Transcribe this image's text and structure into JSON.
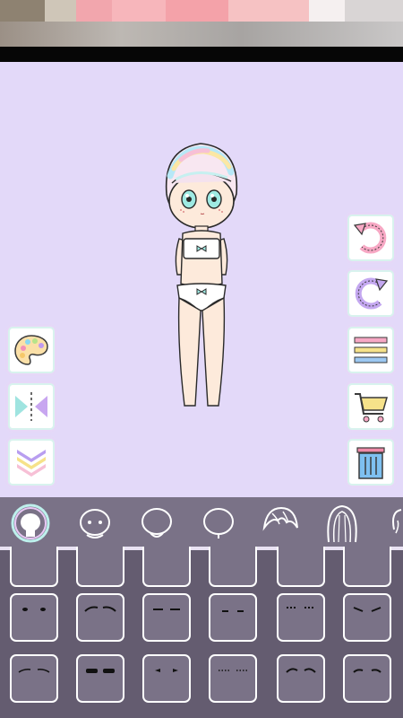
{
  "status_bar": {
    "blurred": true
  },
  "colors": {
    "canvas_bg": "#e3d9f9",
    "tab_bar_bg": "#7a7287",
    "grid_bg": "#645c70",
    "cell_border": "#ffffff"
  },
  "left_tools": [
    {
      "name": "color-palette-button",
      "icon": "palette-icon"
    },
    {
      "name": "flip-button",
      "icon": "mirror-flip-icon"
    },
    {
      "name": "collapse-button",
      "icon": "chevrons-down-icon"
    }
  ],
  "right_tools": [
    {
      "name": "undo-button",
      "icon": "undo-arrow-icon"
    },
    {
      "name": "redo-button",
      "icon": "redo-arrow-icon"
    },
    {
      "name": "menu-button",
      "icon": "menu-lines-icon"
    },
    {
      "name": "shop-button",
      "icon": "shopping-cart-icon"
    },
    {
      "name": "delete-button",
      "icon": "trash-icon"
    }
  ],
  "category_tabs": [
    {
      "name": "tab-body",
      "icon": "body-head-icon",
      "selected": true
    },
    {
      "name": "tab-face",
      "icon": "face-icon",
      "selected": false
    },
    {
      "name": "tab-head-front",
      "icon": "head-outline-icon",
      "selected": false
    },
    {
      "name": "tab-head-side",
      "icon": "head-side-icon",
      "selected": false
    },
    {
      "name": "tab-front-hair",
      "icon": "bangs-icon",
      "selected": false
    },
    {
      "name": "tab-back-hair",
      "icon": "long-hair-icon",
      "selected": false
    },
    {
      "name": "tab-more",
      "icon": "partial-icon",
      "selected": false
    }
  ],
  "eyebrow_options": {
    "rows": 3,
    "columns": 6,
    "selected": null
  }
}
